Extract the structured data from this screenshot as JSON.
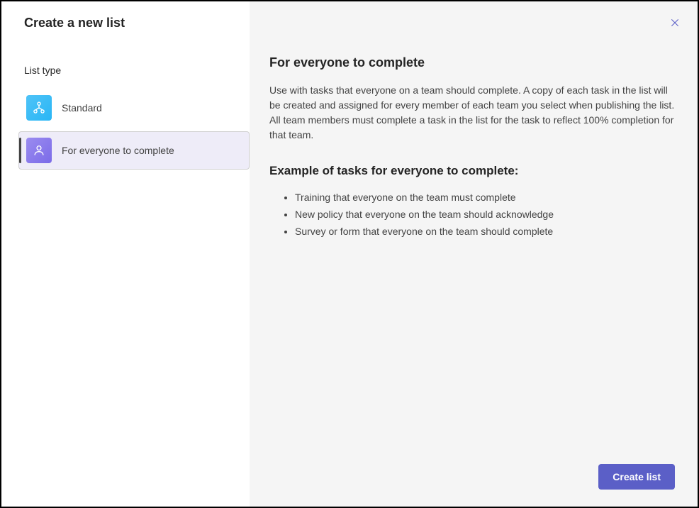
{
  "dialog": {
    "title": "Create a new list"
  },
  "sidebar": {
    "listTypeLabel": "List type",
    "items": [
      {
        "label": "Standard"
      },
      {
        "label": "For everyone to complete"
      }
    ]
  },
  "content": {
    "title": "For everyone to complete",
    "description": "Use with tasks that everyone on a team should complete. A copy of each task in the list will be created and assigned for every member of each team you select when publishing the list. All team members must complete a task in the list for the task to reflect 100% completion for that team.",
    "exampleTitle": "Example of tasks for everyone to complete:",
    "examples": [
      "Training that everyone on the team must complete",
      "New policy that everyone on the team should acknowledge",
      "Survey or form that everyone on the team should complete"
    ]
  },
  "footer": {
    "createLabel": "Create list"
  }
}
